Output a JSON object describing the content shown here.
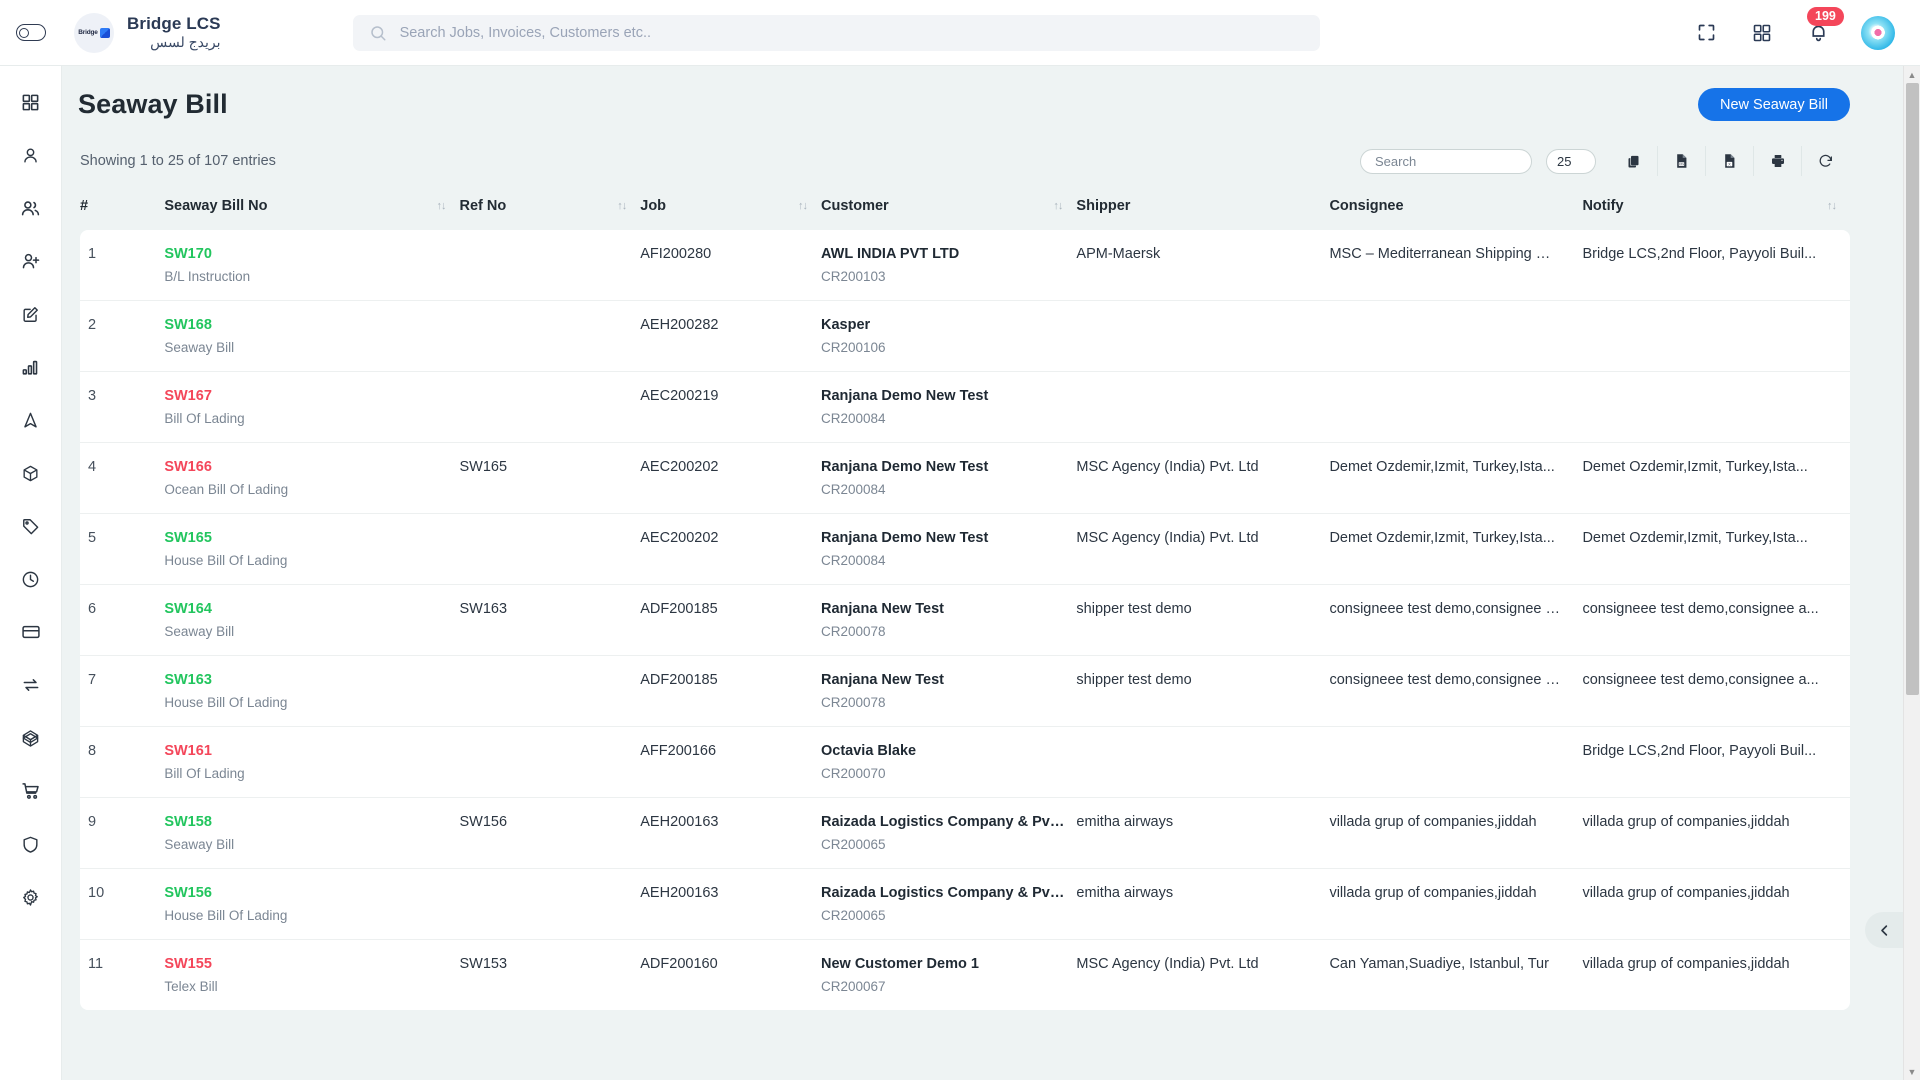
{
  "topbar": {
    "brand_name": "Bridge LCS",
    "brand_name_ar": "بريدج لسس",
    "brand_logo_text": "Bridge",
    "search_placeholder": "Search Jobs, Invoices, Customers etc..",
    "search_value": "",
    "notification_count": "199"
  },
  "sidebar": {
    "items": [
      {
        "icon": "dashboard-grid-icon",
        "name": "dashboard"
      },
      {
        "icon": "user-icon",
        "name": "customers"
      },
      {
        "icon": "users-icon",
        "name": "contacts"
      },
      {
        "icon": "user-plus-icon",
        "name": "add-user"
      },
      {
        "icon": "edit-square-icon",
        "name": "jobs"
      },
      {
        "icon": "bar-chart-icon",
        "name": "reports"
      },
      {
        "icon": "navigation-icon",
        "name": "tracking"
      },
      {
        "icon": "box-icon",
        "name": "packages"
      },
      {
        "icon": "tag-icon",
        "name": "rates"
      },
      {
        "icon": "clock-icon",
        "name": "history"
      },
      {
        "icon": "credit-card-icon",
        "name": "payments"
      },
      {
        "icon": "sync-icon",
        "name": "transactions"
      },
      {
        "icon": "cube-3d-icon",
        "name": "inventory"
      },
      {
        "icon": "shopping-cart-icon",
        "name": "purchase"
      },
      {
        "icon": "shield-icon",
        "name": "security"
      },
      {
        "icon": "gear-icon",
        "name": "settings"
      }
    ]
  },
  "page": {
    "title": "Seaway Bill",
    "new_button": "New Seaway Bill",
    "entries_text": "Showing 1 to 25 of 107 entries",
    "search_placeholder": "Search",
    "search_value": "",
    "page_length": "25",
    "tools": [
      {
        "name": "copy-button",
        "icon": "copy-icon"
      },
      {
        "name": "csv-export-button",
        "icon": "csv-file-icon"
      },
      {
        "name": "excel-export-button",
        "icon": "excel-file-icon"
      },
      {
        "name": "print-button",
        "icon": "printer-icon"
      },
      {
        "name": "refresh-button",
        "icon": "refresh-icon"
      }
    ]
  },
  "table": {
    "columns": [
      {
        "label": "#",
        "sortable": false
      },
      {
        "label": "Seaway Bill No",
        "sortable": true
      },
      {
        "label": "Ref No",
        "sortable": true
      },
      {
        "label": "Job",
        "sortable": true
      },
      {
        "label": "Customer",
        "sortable": true
      },
      {
        "label": "Shipper",
        "sortable": false
      },
      {
        "label": "Consignee",
        "sortable": false
      },
      {
        "label": "Notify",
        "sortable": true
      }
    ],
    "sort_icon": "↑↓",
    "rows": [
      {
        "idx": "1",
        "bill_no": "SW170",
        "bill_color": "green",
        "bill_type": "B/L Instruction",
        "ref_no": "",
        "job": "AFI200280",
        "customer": "AWL INDIA PVT LTD",
        "customer_code": "CR200103",
        "shipper": "APM-Maersk",
        "consignee": "MSC – Mediterranean Shipping Co...",
        "notify": "Bridge LCS,2nd Floor, Payyoli Buil..."
      },
      {
        "idx": "2",
        "bill_no": "SW168",
        "bill_color": "green",
        "bill_type": "Seaway Bill",
        "ref_no": "",
        "job": "AEH200282",
        "customer": "Kasper",
        "customer_code": "CR200106",
        "shipper": "",
        "consignee": "",
        "notify": ""
      },
      {
        "idx": "3",
        "bill_no": "SW167",
        "bill_color": "red",
        "bill_type": "Bill Of Lading",
        "ref_no": "",
        "job": "AEC200219",
        "customer": "Ranjana Demo New Test",
        "customer_code": "CR200084",
        "shipper": "",
        "consignee": "",
        "notify": ""
      },
      {
        "idx": "4",
        "bill_no": "SW166",
        "bill_color": "red",
        "bill_type": "Ocean Bill Of Lading",
        "ref_no": "SW165",
        "job": "AEC200202",
        "customer": "Ranjana Demo New Test",
        "customer_code": "CR200084",
        "shipper": "MSC Agency (India) Pvt. Ltd",
        "consignee": "Demet Ozdemir,Izmit, Turkey,Ista...",
        "notify": "Demet Ozdemir,Izmit, Turkey,Ista..."
      },
      {
        "idx": "5",
        "bill_no": "SW165",
        "bill_color": "green",
        "bill_type": "House Bill Of Lading",
        "ref_no": "",
        "job": "AEC200202",
        "customer": "Ranjana Demo New Test",
        "customer_code": "CR200084",
        "shipper": "MSC Agency (India) Pvt. Ltd",
        "consignee": "Demet Ozdemir,Izmit, Turkey,Ista...",
        "notify": "Demet Ozdemir,Izmit, Turkey,Ista..."
      },
      {
        "idx": "6",
        "bill_no": "SW164",
        "bill_color": "green",
        "bill_type": "Seaway Bill",
        "ref_no": "SW163",
        "job": "ADF200185",
        "customer": "Ranjana New Test",
        "customer_code": "CR200078",
        "shipper": "shipper test demo",
        "consignee": "consigneee test demo,consignee a...",
        "notify": "consigneee test demo,consignee a..."
      },
      {
        "idx": "7",
        "bill_no": "SW163",
        "bill_color": "green",
        "bill_type": "House Bill Of Lading",
        "ref_no": "",
        "job": "ADF200185",
        "customer": "Ranjana New Test",
        "customer_code": "CR200078",
        "shipper": "shipper test demo",
        "consignee": "consigneee test demo,consignee a...",
        "notify": "consigneee test demo,consignee a..."
      },
      {
        "idx": "8",
        "bill_no": "SW161",
        "bill_color": "red",
        "bill_type": "Bill Of Lading",
        "ref_no": "",
        "job": "AFF200166",
        "customer": "Octavia Blake",
        "customer_code": "CR200070",
        "shipper": "",
        "consignee": "",
        "notify": "Bridge LCS,2nd Floor, Payyoli Buil..."
      },
      {
        "idx": "9",
        "bill_no": "SW158",
        "bill_color": "green",
        "bill_type": "Seaway Bill",
        "ref_no": "SW156",
        "job": "AEH200163",
        "customer": "Raizada Logistics Company & Pvt ...",
        "customer_code": "CR200065",
        "shipper": "emitha airways",
        "consignee": "villada grup of companies,jiddah",
        "notify": "villada grup of companies,jiddah"
      },
      {
        "idx": "10",
        "bill_no": "SW156",
        "bill_color": "green",
        "bill_type": "House Bill Of Lading",
        "ref_no": "",
        "job": "AEH200163",
        "customer": "Raizada Logistics Company & Pvt ...",
        "customer_code": "CR200065",
        "shipper": "emitha airways",
        "consignee": "villada grup of companies,jiddah",
        "notify": "villada grup of companies,jiddah"
      },
      {
        "idx": "11",
        "bill_no": "SW155",
        "bill_color": "red",
        "bill_type": "Telex Bill",
        "ref_no": "SW153",
        "job": "ADF200160",
        "customer": "New Customer Demo 1",
        "customer_code": "CR200067",
        "shipper": "MSC Agency (India) Pvt. Ltd",
        "consignee": "Can Yaman,Suadiye, Istanbul, Tur",
        "notify": " villada grup of companies,jiddah"
      }
    ]
  },
  "colors": {
    "accent": "#1673e8",
    "green": "#22c55e",
    "red": "#f4465a",
    "badge": "#f4465a",
    "page_bg": "#eef3f3"
  }
}
